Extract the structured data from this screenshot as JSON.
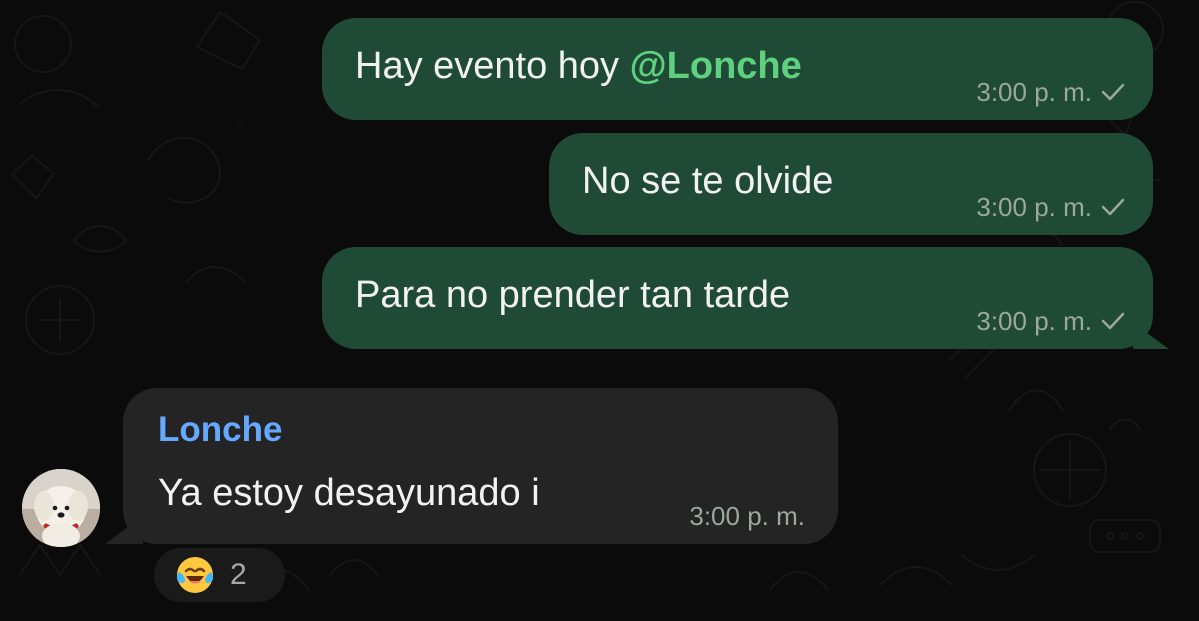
{
  "chat": {
    "messages": [
      {
        "direction": "outgoing",
        "text": "Hay evento hoy ",
        "mention": "@Lonche",
        "time": "3:00 p. m.",
        "status_icon": "single-check-icon"
      },
      {
        "direction": "outgoing",
        "text": "No se te olvide",
        "time": "3:00 p. m.",
        "status_icon": "single-check-icon"
      },
      {
        "direction": "outgoing",
        "text": "Para no prender tan tarde",
        "time": "3:00 p. m.",
        "status_icon": "single-check-icon"
      },
      {
        "direction": "incoming",
        "sender": "Lonche",
        "text": "Ya estoy desayunado i",
        "time": "3:00 p. m.",
        "reaction": {
          "emoji_icon": "laughing-tears-emoji-icon",
          "count": "2"
        }
      }
    ]
  },
  "colors": {
    "background": "#0b0b0b",
    "outgoing_bubble": "#1f4a35",
    "incoming_bubble": "#242424",
    "mention": "#5fd07f",
    "sender_name": "#67a8ff",
    "meta_text": "#9ba79f"
  }
}
